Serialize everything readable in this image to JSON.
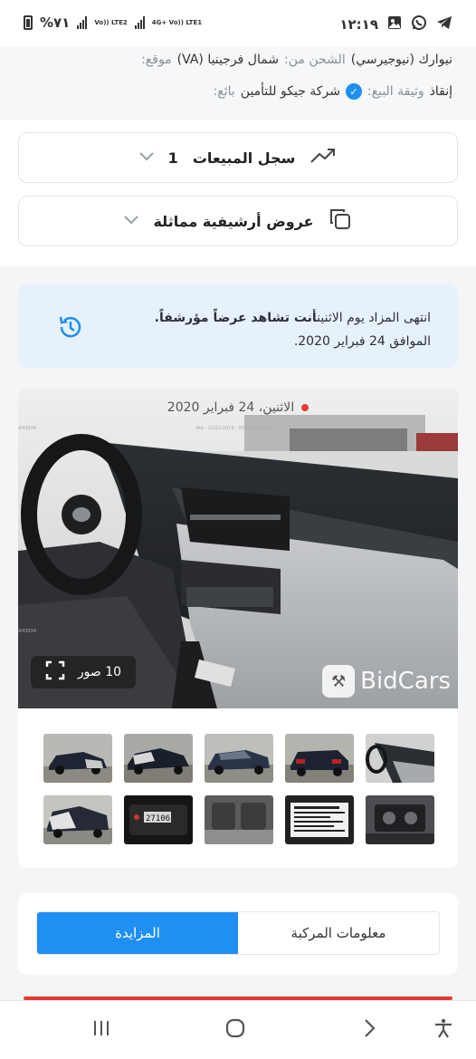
{
  "status_bar": {
    "time": "١٢:١٩",
    "battery": "%٧١",
    "net1": "Vo)) LTE2",
    "net2": "4G+ Vo)) LTE1",
    "icons": [
      "telegram-icon",
      "whatsapp-icon",
      "gallery-icon"
    ]
  },
  "listing": {
    "location_value": "نيوارك (نيوجيرسي)",
    "ship_from_label": "الشحن من:",
    "ship_from_value": "شمال فرجينيا (VA)",
    "location_label": "موقع:",
    "doc_value": "إنقاذ",
    "doc_label": "وثيقة البيع:",
    "seller_value": "شركة جيكو للتأمين",
    "seller_label": "بائع:"
  },
  "sales_history": {
    "label": "سجل المبيعات",
    "count": "1"
  },
  "similar_offers": {
    "label": "عروض أرشيفية مماثلة"
  },
  "notice": {
    "line1_a": "انتهى المزاد يوم الاثنين",
    "line1_b": "أنت تشاهد عرضاً مؤرشفاً.",
    "line2": "الموافق 24 فبراير 2020."
  },
  "gallery": {
    "date": "الاثنين، 24 فبراير 2020",
    "photo_count": "10 صور",
    "brand": "BidCars",
    "thumbnails": 10
  },
  "tabs": {
    "vehicle_info": "معلومات المركبة",
    "auction": "المزايدة",
    "active": "auction"
  },
  "colors": {
    "accent": "#1f8ff2",
    "notice_bg": "#e6f1fc",
    "alert": "#e53935"
  }
}
